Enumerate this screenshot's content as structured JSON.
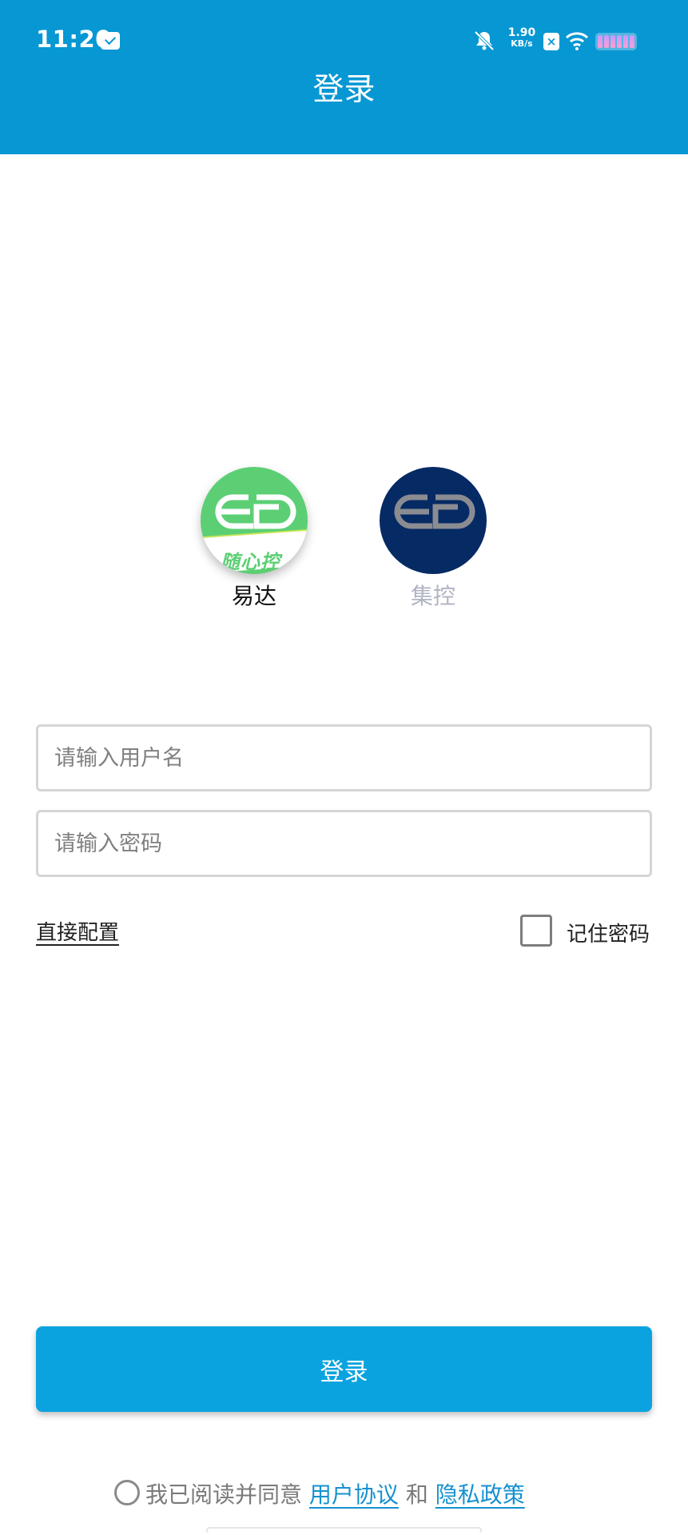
{
  "status_bar": {
    "time": "11:20",
    "speed_value": "1.90",
    "speed_unit": "KB/s",
    "icons": [
      "mail-icon",
      "bell-muted-icon",
      "x-notification-icon",
      "wifi-icon",
      "battery-icon"
    ]
  },
  "header": {
    "title": "登录"
  },
  "brands": [
    {
      "name": "易达",
      "slogan": "随心控",
      "selected": true
    },
    {
      "name": "集控",
      "selected": false
    }
  ],
  "form": {
    "username_placeholder": "请输入用户名",
    "username_value": "",
    "password_placeholder": "请输入密码",
    "password_value": "",
    "direct_config": "直接配置",
    "remember_label": "记住密码",
    "remember_checked": false
  },
  "login_button": "登录",
  "agreement": {
    "prefix": "我已阅读并同意",
    "user_agreement": "用户协议",
    "and": "和",
    "privacy_policy": "隐私政策"
  },
  "colors": {
    "header": "#0797d3",
    "button": "#0aa3df",
    "link": "#1791cf",
    "brand_selected_text": "#111111",
    "brand_unselected_text": "#b0b4c3",
    "yida_green": "#5ccf74",
    "jikong_navy": "#062a64"
  }
}
